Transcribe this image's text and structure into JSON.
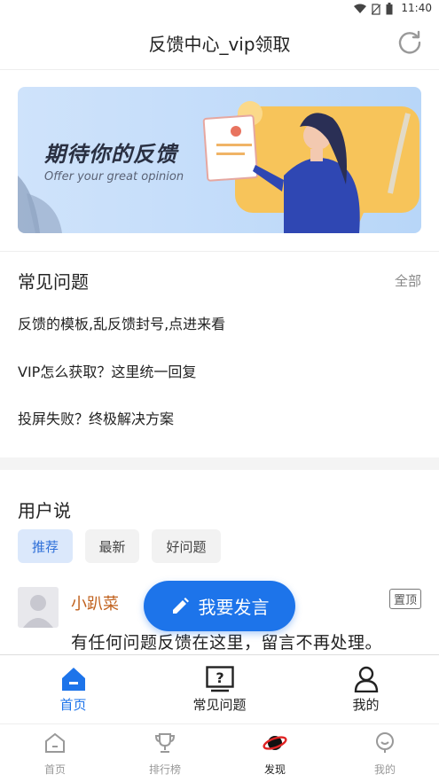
{
  "status_bar": {
    "time": "11:40"
  },
  "header": {
    "title": "反馈中心_vip领取"
  },
  "banner": {
    "headline": "期待你的反馈",
    "subline": "Offer your great opinion"
  },
  "faq": {
    "title": "常见问题",
    "all_label": "全部",
    "items": [
      "反馈的模板,乱反馈封号,点进来看",
      "VIP怎么获取？这里统一回复",
      "投屏失败？终极解决方案"
    ]
  },
  "user_says": {
    "title": "用户说",
    "chips": [
      "推荐",
      "最新",
      "好问题"
    ],
    "post": {
      "username": "小趴菜",
      "pin_label": "置顶",
      "text": "有任何问题反馈在这里，留言不再处理。"
    }
  },
  "fab": {
    "label": "我要发言"
  },
  "sub_tabs": [
    "首页",
    "常见问题",
    "我的"
  ],
  "bottom_nav": [
    "首页",
    "排行榜",
    "发现",
    "我的"
  ],
  "colors": {
    "accent": "#1d74ea",
    "username": "#c0601c",
    "banner_bg": "#cfe3fb"
  }
}
